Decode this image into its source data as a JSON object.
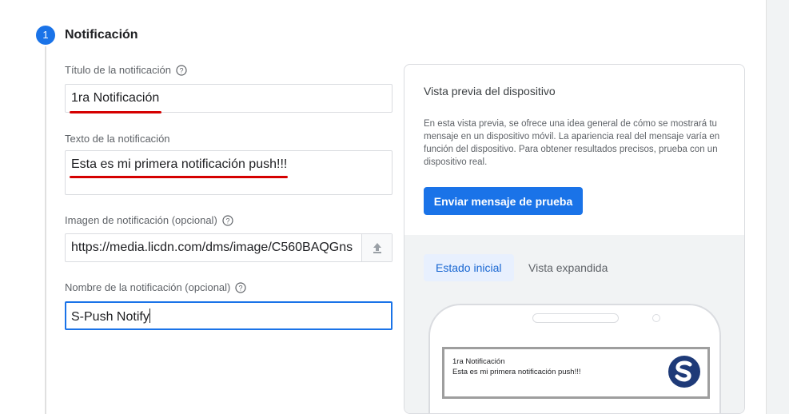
{
  "step": {
    "number": "1",
    "title": "Notificación"
  },
  "fields": {
    "title": {
      "label": "Título de la notificación",
      "value": "1ra Notificación"
    },
    "text": {
      "label": "Texto de la notificación",
      "value": "Esta es mi primera notificación push!!!"
    },
    "image": {
      "label": "Imagen de notificación (opcional)",
      "value": "https://media.licdn.com/dms/image/C560BAQGns"
    },
    "name": {
      "label": "Nombre de la notificación (opcional)",
      "value": "S-Push Notify"
    }
  },
  "preview": {
    "title": "Vista previa del dispositivo",
    "description": "En esta vista previa, se ofrece una idea general de cómo se mostrará tu mensaje en un dispositivo móvil. La apariencia real del mensaje varía en función del dispositivo. Para obtener resultados precisos, prueba con un dispositivo real.",
    "test_button": "Enviar mensaje de prueba",
    "tabs": [
      "Estado inicial",
      "Vista expandida"
    ],
    "notification": {
      "title": "1ra Notificación",
      "body": "Esta es mi primera notificación push!!!"
    }
  },
  "colors": {
    "accent": "#1a73e8",
    "underline": "#d50000",
    "logo": "#1e3a78"
  },
  "icons": {
    "help": "help-circle-icon",
    "upload": "upload-icon",
    "logo": "s-logo-icon"
  }
}
